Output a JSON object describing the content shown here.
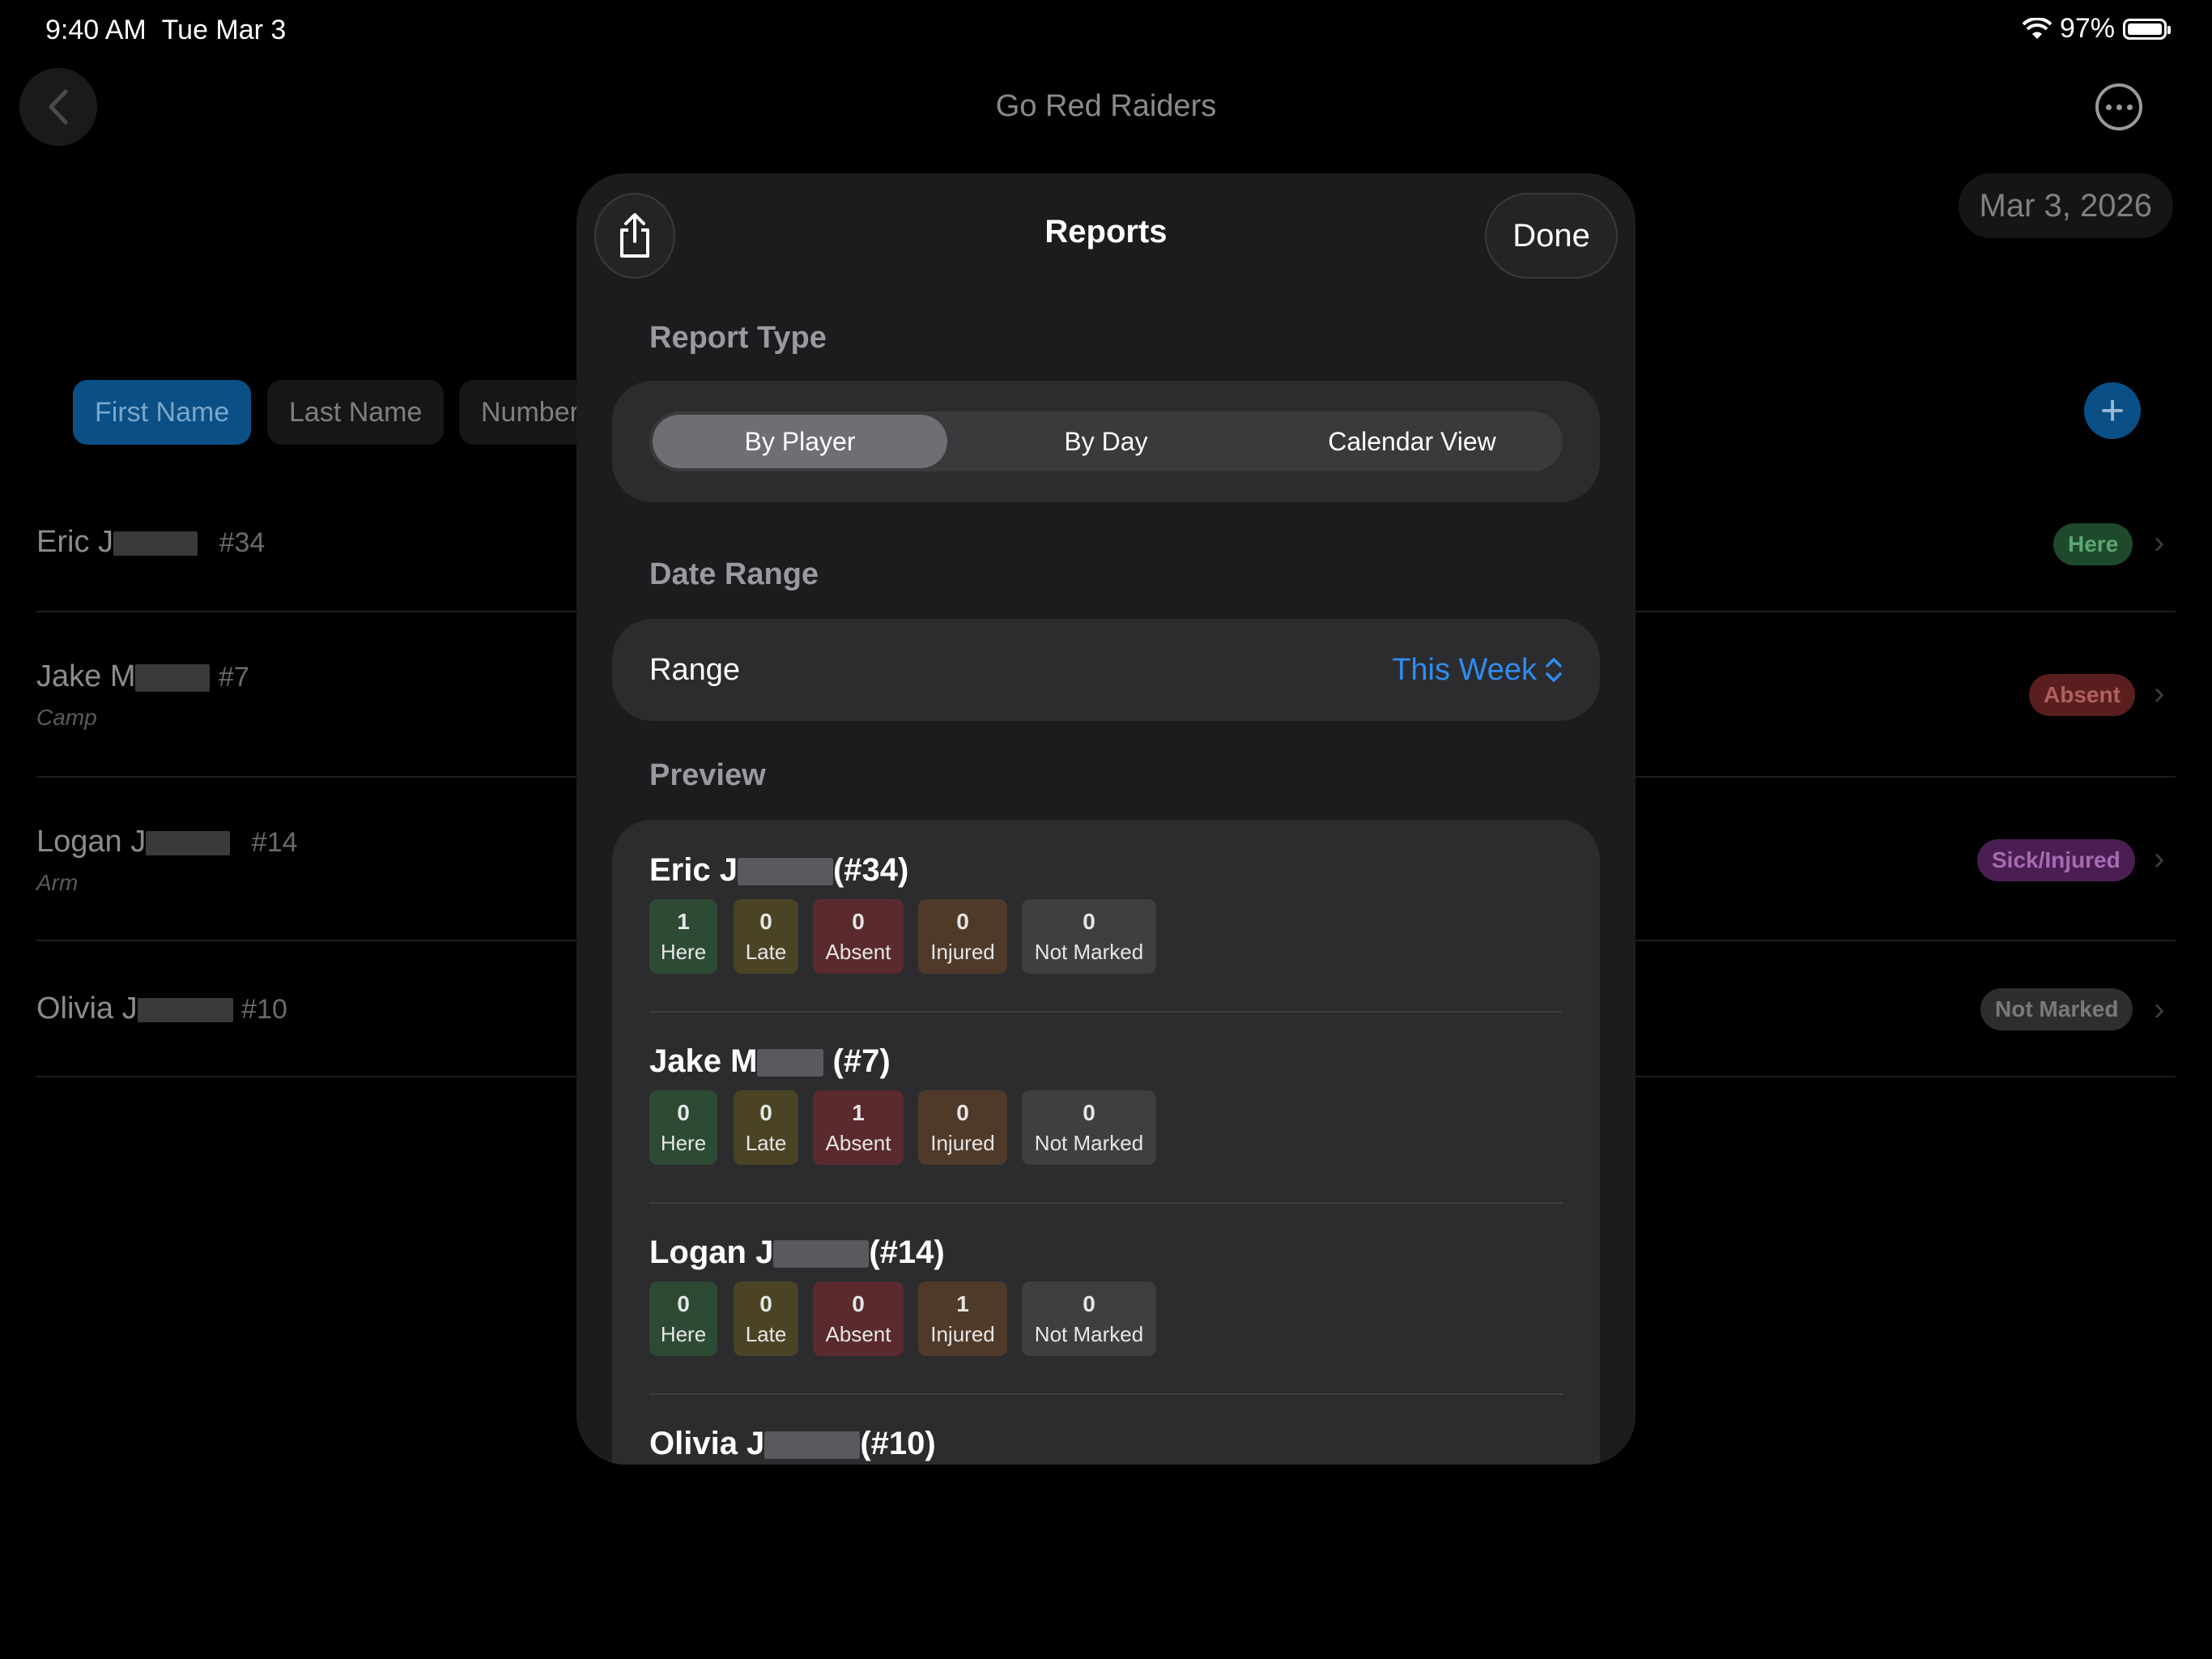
{
  "status_bar": {
    "time": "9:40 AM",
    "date": "Tue Mar 3",
    "battery": "97%"
  },
  "background": {
    "title": "Go Red Raiders",
    "date": "Mar 3, 2026",
    "sort_options": [
      "First Name",
      "Last Name",
      "Number"
    ],
    "players": [
      {
        "first": "Eric J",
        "number": "#34",
        "note": "",
        "status": "Here"
      },
      {
        "first": "Jake M",
        "number": "#7",
        "note": "Camp",
        "status": "Absent"
      },
      {
        "first": "Logan J",
        "number": "#14",
        "note": "Arm",
        "status": "Sick/Injured"
      },
      {
        "first": "Olivia J",
        "number": "#10",
        "note": "",
        "status": "Not Marked"
      }
    ]
  },
  "modal": {
    "title": "Reports",
    "done_label": "Done",
    "report_type_label": "Report Type",
    "report_types": [
      "By Player",
      "By Day",
      "Calendar View"
    ],
    "selected_report_type": "By Player",
    "date_range_label": "Date Range",
    "range_label": "Range",
    "range_value": "This Week",
    "preview_label": "Preview",
    "stat_labels": [
      "Here",
      "Late",
      "Absent",
      "Injured",
      "Not Marked"
    ],
    "preview": [
      {
        "name": "Eric J",
        "number": "(#34)",
        "stats": [
          "1",
          "0",
          "0",
          "0",
          "0"
        ]
      },
      {
        "name": "Jake M",
        "number": "(#7)",
        "stats": [
          "0",
          "0",
          "1",
          "0",
          "0"
        ]
      },
      {
        "name": "Logan J",
        "number": "(#14)",
        "stats": [
          "0",
          "0",
          "0",
          "1",
          "0"
        ]
      },
      {
        "name": "Olivia J",
        "number": "(#10)",
        "stats": []
      }
    ]
  },
  "colors": {
    "here": "#2d4a35",
    "late": "#4a4425",
    "absent": "#5a2a2e",
    "injured": "#4f3a2a",
    "not_marked": "#3f3f42",
    "accent": "#2f8cf0"
  },
  "icons": [
    "back-chevron-icon",
    "ellipsis-circle-icon",
    "plus-icon",
    "share-icon",
    "chevron-right-icon",
    "up-down-chevron-icon",
    "wifi-icon",
    "battery-icon"
  ]
}
